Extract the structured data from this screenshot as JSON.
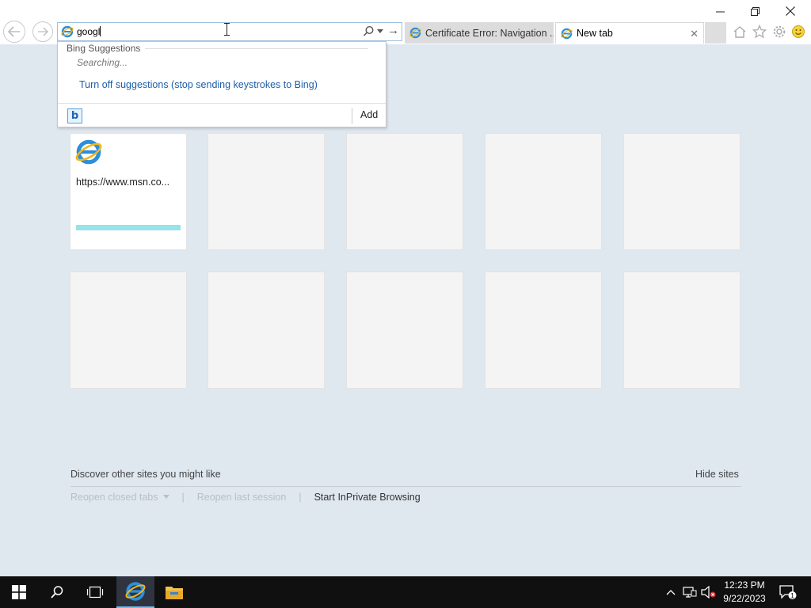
{
  "browser": {
    "address_value": "googl",
    "tabs": [
      {
        "label": "Certificate Error: Navigation ..."
      },
      {
        "label": "New tab"
      }
    ]
  },
  "suggestions": {
    "header": "Bing Suggestions",
    "status": "Searching...",
    "turn_off": "Turn off suggestions (stop sending keystrokes to Bing)",
    "provider_icon": "b",
    "add": "Add"
  },
  "tiles": {
    "site_url": "https://www.msn.co...",
    "empty_count": 9
  },
  "footer": {
    "discover": "Discover other sites you might like",
    "hide_sites": "Hide sites",
    "reopen_tabs": "Reopen closed tabs",
    "reopen_session": "Reopen last session",
    "inprivate": "Start InPrivate Browsing"
  },
  "taskbar": {
    "time": "12:23 PM",
    "date": "9/22/2023",
    "notification_count": "1"
  },
  "colors": {
    "page_bg": "#dfe7ef",
    "taskbar_bg": "#101010",
    "link_blue": "#1c5fa8",
    "tile_bar": "#96e3ea"
  }
}
